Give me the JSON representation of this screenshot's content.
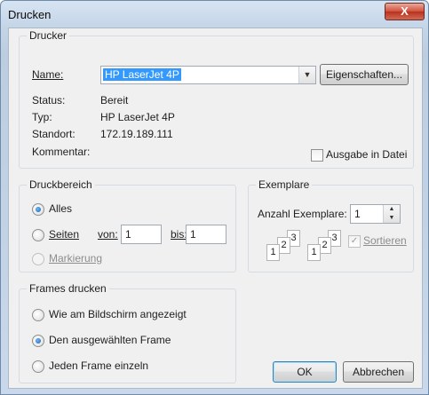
{
  "window": {
    "title": "Drucken",
    "close_label": "X"
  },
  "printer": {
    "group_label": "Drucker",
    "name_label": "Name:",
    "name_value": "HP LaserJet 4P",
    "properties_button": "Eigenschaften...",
    "status_label": "Status:",
    "status_value": "Bereit",
    "type_label": "Typ:",
    "type_value": "HP LaserJet 4P",
    "location_label": "Standort:",
    "location_value": "172.19.189.111",
    "comment_label": "Kommentar:",
    "print_to_file_label": "Ausgabe in Datei",
    "print_to_file_checked": false
  },
  "range": {
    "group_label": "Druckbereich",
    "all_label": "Alles",
    "pages_label": "Seiten",
    "from_label": "von:",
    "from_value": "1",
    "to_label": "bis:",
    "to_value": "1",
    "selection_label": "Markierung",
    "selected": "all"
  },
  "copies": {
    "group_label": "Exemplare",
    "count_label": "Anzahl Exemplare:",
    "count_value": "1",
    "collate_label": "Sortieren",
    "collate_checked": true,
    "collate_disabled": true,
    "page_digits": [
      "1",
      "2",
      "3"
    ]
  },
  "frames": {
    "group_label": "Frames drucken",
    "options": [
      "Wie am Bildschirm angezeigt",
      "Den ausgewählten Frame",
      "Jeden Frame einzeln"
    ],
    "selected_index": 1
  },
  "buttons": {
    "ok": "OK",
    "cancel": "Abbrechen"
  }
}
